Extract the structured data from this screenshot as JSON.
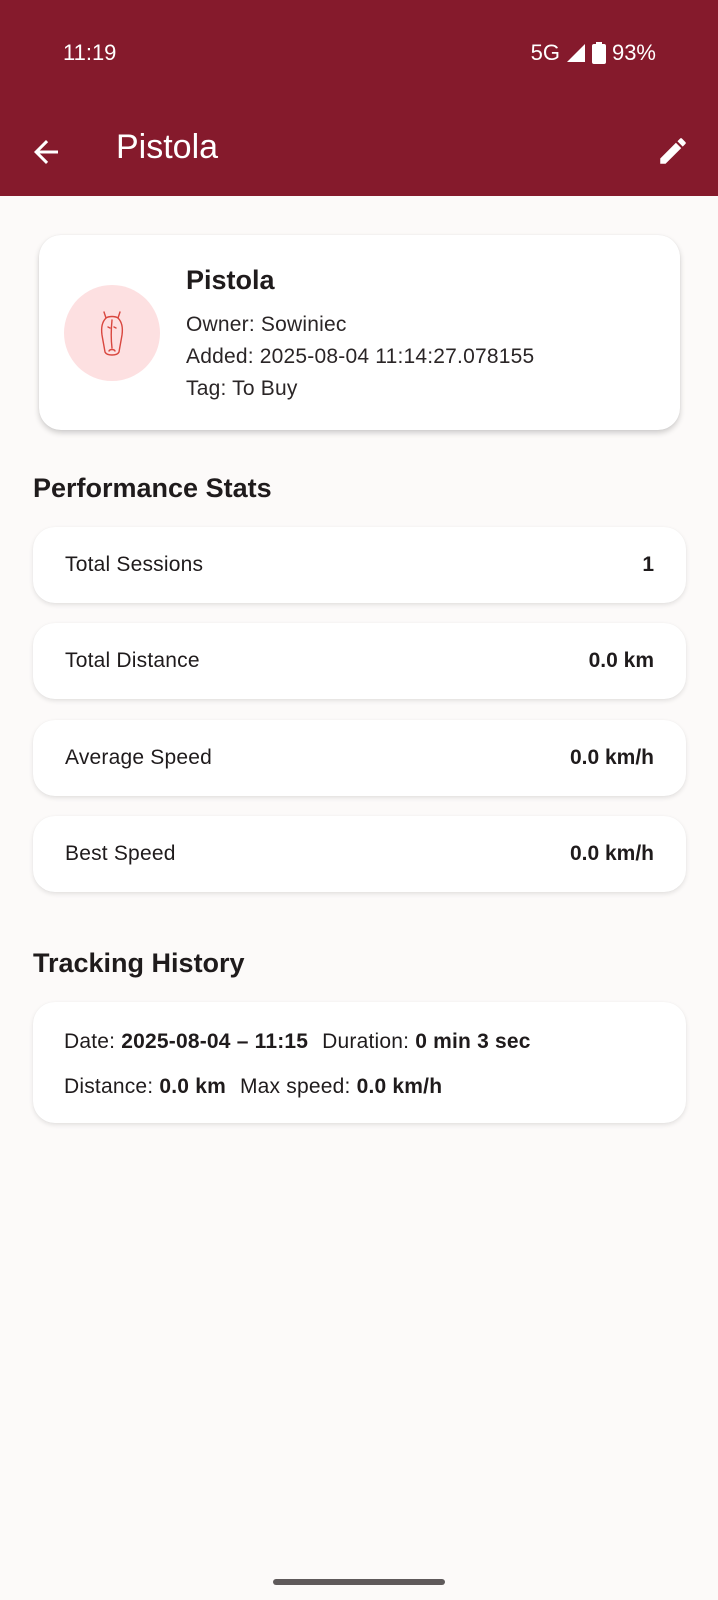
{
  "status_bar": {
    "time": "11:19",
    "network": "5G",
    "battery": "93%"
  },
  "app_bar": {
    "title": "Pistola",
    "back_icon": "arrow-back-icon",
    "edit_icon": "pencil-icon",
    "background_color": "#851a2c"
  },
  "profile": {
    "avatar_icon": "horse-head-icon",
    "name": "Pistola",
    "owner": "Owner: Sowiniec",
    "added": "Added: 2025-08-04 11:14:27.078155",
    "tag": "Tag: To Buy"
  },
  "performance": {
    "title": "Performance Stats",
    "stats": [
      {
        "label": "Total Sessions",
        "value": "1"
      },
      {
        "label": "Total Distance",
        "value": "0.0 km"
      },
      {
        "label": "Average Speed",
        "value": "0.0 km/h"
      },
      {
        "label": "Best Speed",
        "value": "0.0 km/h"
      }
    ]
  },
  "history": {
    "title": "Tracking History",
    "entries": [
      {
        "date_label": "Date:",
        "date_value": "2025-08-04 – 11:15",
        "duration_label": "Duration:",
        "duration_value": "0 min 3 sec",
        "distance_label": "Distance:",
        "distance_value": "0.0 km",
        "max_speed_label": "Max speed:",
        "max_speed_value": "0.0 km/h"
      }
    ]
  }
}
